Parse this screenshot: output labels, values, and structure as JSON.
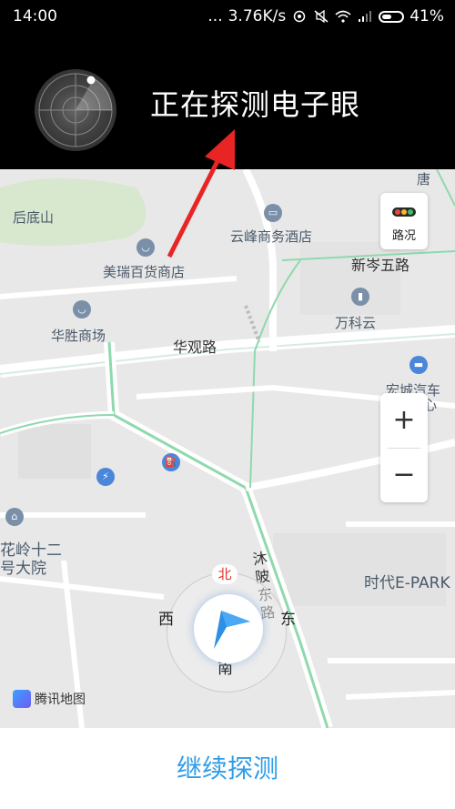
{
  "status_bar": {
    "time": "14:00",
    "dots": "...",
    "network_speed": "3.76K/s",
    "battery_percent": "41%"
  },
  "banner": {
    "title": "正在探测电子眼"
  },
  "map": {
    "labels": {
      "houdishan": "后底山",
      "yunfeng_hotel": "云峰商务酒店",
      "meirui_store": "美瑞百货商店",
      "xincen_road": "新岑五路",
      "huasheng_market": "华胜商场",
      "vanke": "万科云",
      "huaguan_road": "华观路",
      "hongcheng_auto": "宏城汽车",
      "hongcheng_center": "中心",
      "tang": "唐",
      "hualing": "花岭十二",
      "hualing2": "号大院",
      "mubei_road": "沐陂东路",
      "shidai_epark": "时代E-PARK"
    },
    "traffic_label": "路况",
    "zoom_in": "+",
    "zoom_out": "−",
    "compass": {
      "north": "北",
      "south": "南",
      "east": "东",
      "west": "西"
    },
    "logo_text": "腾讯地图"
  },
  "bottom": {
    "continue_label": "继续探测"
  },
  "colors": {
    "accent_blue": "#2f9de8",
    "arrow_red": "#e82424",
    "road_green": "#7fd3a0"
  }
}
